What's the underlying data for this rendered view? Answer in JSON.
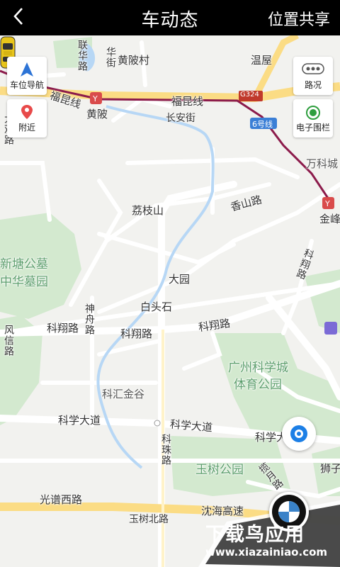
{
  "header": {
    "title": "车动态",
    "share": "位置共享"
  },
  "controls": {
    "car_navigation": "车位导航",
    "nearby": "附近",
    "traffic": "路况",
    "geofence": "电子围栏"
  },
  "map": {
    "labels": {
      "huangpi_village": "黄陂村",
      "wenwu": "温屋",
      "fukun_line_1": "福昆线",
      "fukun_line_2": "福昆线",
      "huangpi": "黄陂",
      "changan_street": "长安街",
      "g324": "G324",
      "line6": "6号线",
      "wanke": "万科城",
      "lizhishan": "荔枝山",
      "xiangshan_road": "香山路",
      "jinfeng": "金峰",
      "xintang_cemetery": "新塘公墓",
      "zhonghua_cemetery": "中华墓园",
      "dayuan": "大园",
      "baitoushi": "白头石",
      "kexiang_road_1": "科翔路",
      "kexiang_road_2": "科翔路",
      "kexiang_road_3": "科翔路",
      "kexiang_road_v": "科翔路",
      "shenzhou_road": "神舟路",
      "gz_science_sports_park_1": "广州科学城",
      "gz_science_sports_park_2": "体育公园",
      "kehui_jingu": "科汇金谷",
      "kexue_avenue_1": "科学大道",
      "kexue_avenue_2": "科学大道",
      "kexue_avenue_3": "科学大",
      "kezhu_road": "科珠路",
      "yushu_park": "玉树公园",
      "lanyue_road": "揽月路",
      "shizi": "狮子",
      "guangpu_west_road": "光谱西路",
      "shenhai_expressway": "沈海高速",
      "yushu_north_road": "玉树北路",
      "lianhua_road": "联华路",
      "huajie": "华街",
      "dagang_road": "大观路",
      "fengxin_road": "风信路"
    }
  },
  "watermark": {
    "main": "下载鸟应用",
    "url": "www.xiazainiao.com"
  },
  "colors": {
    "topbar": "#000000",
    "accent_blue": "#1c7fe6",
    "subway": "#8c1b4b",
    "park_green": "#d3e9cf",
    "road_yellow": "#fbdc84"
  }
}
